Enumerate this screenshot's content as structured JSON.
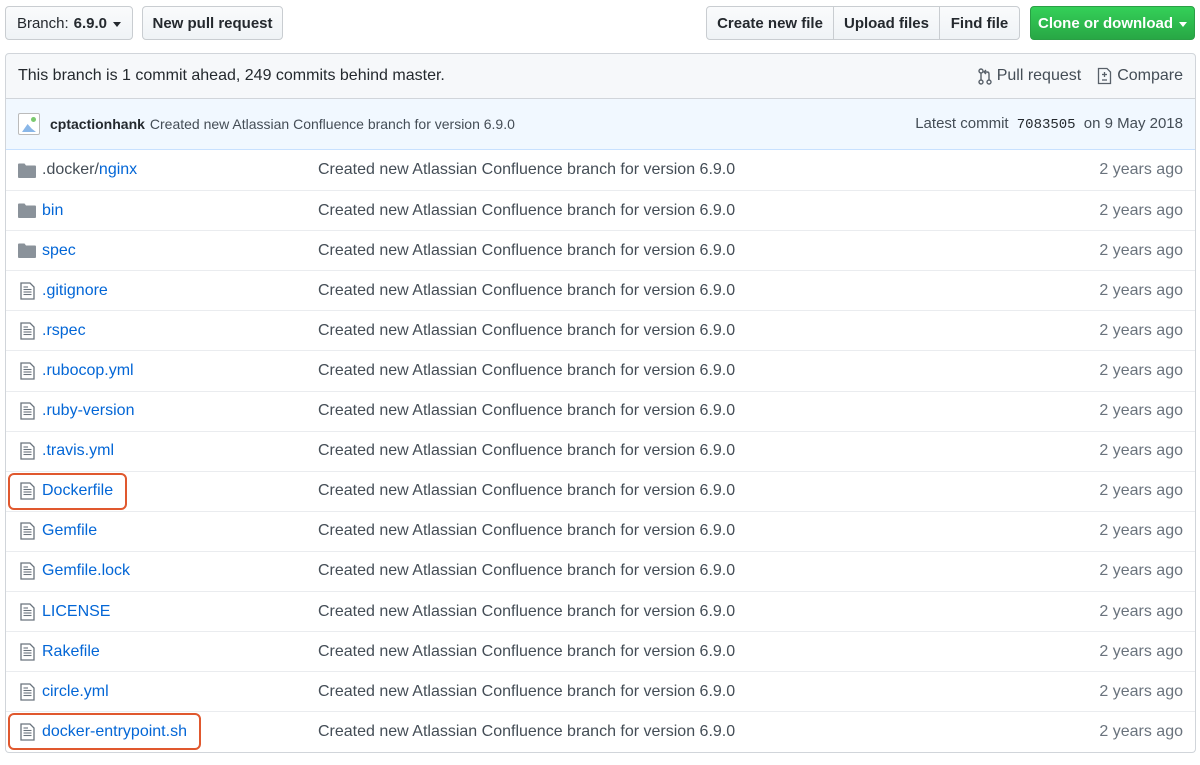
{
  "toolbar": {
    "branch_prefix": "Branch:",
    "branch_value": "6.9.0",
    "new_pull_request": "New pull request",
    "create_new_file": "Create new file",
    "upload_files": "Upload files",
    "find_file": "Find file",
    "clone_or_download": "Clone or download"
  },
  "branch_info": {
    "message": "This branch is 1 commit ahead, 249 commits behind master.",
    "pull_request": "Pull request",
    "compare": "Compare"
  },
  "latest_commit": {
    "author": "cptactionhank",
    "message": "Created new Atlassian Confluence branch for version 6.9.0",
    "prefix": "Latest commit",
    "sha": "7083505",
    "date": "on 9 May 2018"
  },
  "files": [
    {
      "type": "dir",
      "name_dim": ".docker/",
      "name": "nginx",
      "message": "Created new Atlassian Confluence branch for version 6.9.0",
      "age": "2 years ago",
      "highlighted": false
    },
    {
      "type": "dir",
      "name_dim": "",
      "name": "bin",
      "message": "Created new Atlassian Confluence branch for version 6.9.0",
      "age": "2 years ago",
      "highlighted": false
    },
    {
      "type": "dir",
      "name_dim": "",
      "name": "spec",
      "message": "Created new Atlassian Confluence branch for version 6.9.0",
      "age": "2 years ago",
      "highlighted": false
    },
    {
      "type": "file",
      "name_dim": "",
      "name": ".gitignore",
      "message": "Created new Atlassian Confluence branch for version 6.9.0",
      "age": "2 years ago",
      "highlighted": false
    },
    {
      "type": "file",
      "name_dim": "",
      "name": ".rspec",
      "message": "Created new Atlassian Confluence branch for version 6.9.0",
      "age": "2 years ago",
      "highlighted": false
    },
    {
      "type": "file",
      "name_dim": "",
      "name": ".rubocop.yml",
      "message": "Created new Atlassian Confluence branch for version 6.9.0",
      "age": "2 years ago",
      "highlighted": false
    },
    {
      "type": "file",
      "name_dim": "",
      "name": ".ruby-version",
      "message": "Created new Atlassian Confluence branch for version 6.9.0",
      "age": "2 years ago",
      "highlighted": false
    },
    {
      "type": "file",
      "name_dim": "",
      "name": ".travis.yml",
      "message": "Created new Atlassian Confluence branch for version 6.9.0",
      "age": "2 years ago",
      "highlighted": false
    },
    {
      "type": "file",
      "name_dim": "",
      "name": "Dockerfile",
      "message": "Created new Atlassian Confluence branch for version 6.9.0",
      "age": "2 years ago",
      "highlighted": true
    },
    {
      "type": "file",
      "name_dim": "",
      "name": "Gemfile",
      "message": "Created new Atlassian Confluence branch for version 6.9.0",
      "age": "2 years ago",
      "highlighted": false
    },
    {
      "type": "file",
      "name_dim": "",
      "name": "Gemfile.lock",
      "message": "Created new Atlassian Confluence branch for version 6.9.0",
      "age": "2 years ago",
      "highlighted": false
    },
    {
      "type": "file",
      "name_dim": "",
      "name": "LICENSE",
      "message": "Created new Atlassian Confluence branch for version 6.9.0",
      "age": "2 years ago",
      "highlighted": false
    },
    {
      "type": "file",
      "name_dim": "",
      "name": "Rakefile",
      "message": "Created new Atlassian Confluence branch for version 6.9.0",
      "age": "2 years ago",
      "highlighted": false
    },
    {
      "type": "file",
      "name_dim": "",
      "name": "circle.yml",
      "message": "Created new Atlassian Confluence branch for version 6.9.0",
      "age": "2 years ago",
      "highlighted": false
    },
    {
      "type": "file",
      "name_dim": "",
      "name": "docker-entrypoint.sh",
      "message": "Created new Atlassian Confluence branch for version 6.9.0",
      "age": "2 years ago",
      "highlighted": true
    }
  ],
  "colors": {
    "link": "#0366d6",
    "clone_button": "#28a745",
    "highlight_box": "#e0582e",
    "commit_bar_bg": "#f1f8ff"
  },
  "icons": {
    "dir": "folder-icon",
    "file": "file-icon"
  }
}
